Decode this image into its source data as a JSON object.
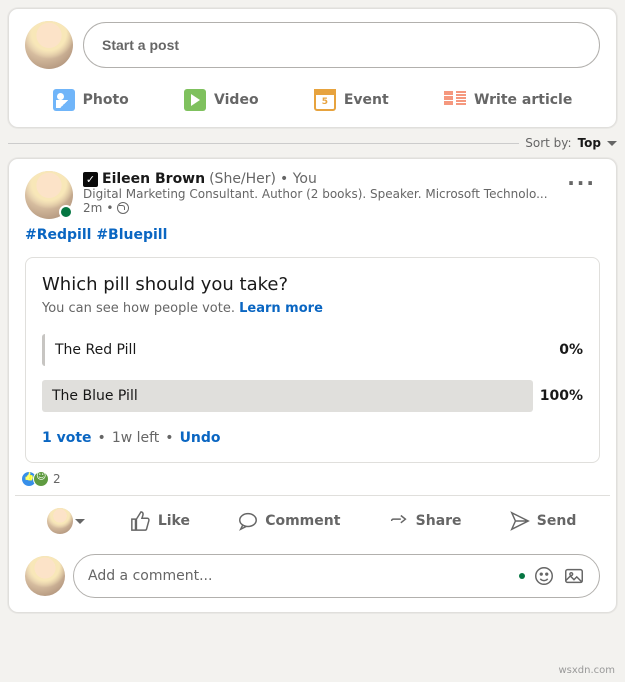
{
  "compose": {
    "start_placeholder": "Start a post",
    "photo": "Photo",
    "video": "Video",
    "event": "Event",
    "write_article": "Write article"
  },
  "sort": {
    "label": "Sort by:",
    "value": "Top"
  },
  "post": {
    "author": "Eileen Brown",
    "pronouns": "(She/Her)",
    "you": "• You",
    "headline": "Digital Marketing Consultant. Author (2 books). Speaker. Microsoft Technolo...",
    "time": "2m",
    "hashtags": "#Redpill #Bluepill"
  },
  "poll": {
    "question": "Which pill should you take?",
    "sub": "You can see how people vote.",
    "learn": "Learn more",
    "options": [
      {
        "label": "The Red Pill",
        "pct": "0%"
      },
      {
        "label": "The Blue Pill",
        "pct": "100%"
      }
    ],
    "votes": "1 vote",
    "time_left": "1w left",
    "undo": "Undo"
  },
  "reactions": {
    "count": "2"
  },
  "actions": {
    "like": "Like",
    "comment": "Comment",
    "share": "Share",
    "send": "Send"
  },
  "comment_box": {
    "placeholder": "Add a comment..."
  },
  "watermark": "wsxdn.com"
}
